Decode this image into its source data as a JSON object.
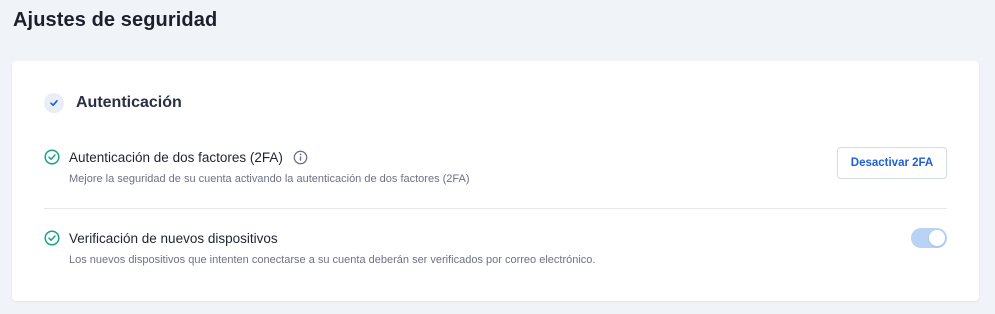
{
  "page": {
    "title": "Ajustes de seguridad"
  },
  "section": {
    "title": "Autenticación",
    "icon": "checkmark-icon"
  },
  "settings": [
    {
      "title": "Autenticación de dos factores (2FA)",
      "description": "Mejore la seguridad de su cuenta activando la autenticación de dos factores (2FA)",
      "status_icon": "check-circle-icon",
      "info_icon": "info-icon",
      "action_label": "Desactivar 2FA"
    },
    {
      "title": "Verificación de nuevos dispositivos",
      "description": "Los nuevos dispositivos que intenten conectarse a su cuenta deberán ser verificados por correo electrónico.",
      "status_icon": "check-circle-icon",
      "toggle_on": true
    }
  ],
  "colors": {
    "background": "#f0f3f8",
    "card": "#ffffff",
    "success": "#1aa38a",
    "accent": "#1f5fd6",
    "toggle_track": "#b9d3f5"
  }
}
